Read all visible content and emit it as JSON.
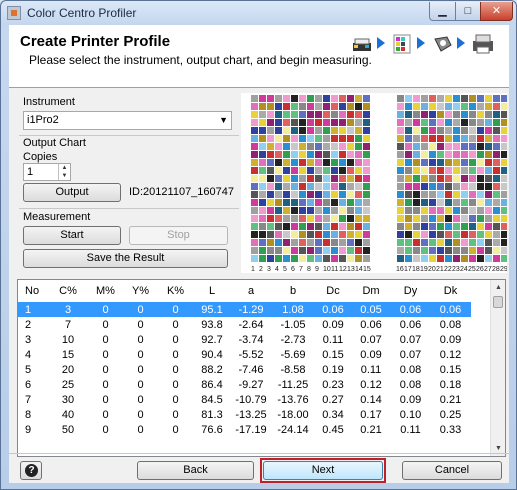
{
  "window": {
    "title": "Color Centro Profiler"
  },
  "header": {
    "title": "Create Printer Profile",
    "subtitle": "Please select the instrument, output chart, and begin measuring."
  },
  "instrument": {
    "label": "Instrument",
    "selected": "i1Pro2"
  },
  "output_chart": {
    "label": "Output Chart",
    "copies_label": "Copies",
    "copies_value": "1",
    "output_button": "Output",
    "id_text": "ID:20121107_160747"
  },
  "measurement": {
    "label": "Measurement",
    "start_button": "Start",
    "stop_button": "Stop",
    "save_button": "Save the Result"
  },
  "chart_labels": {
    "left": [
      "1",
      "2",
      "3",
      "4",
      "5",
      "6",
      "7",
      "8",
      "9",
      "10",
      "11",
      "12",
      "13",
      "14",
      "15"
    ],
    "right": [
      "16",
      "17",
      "18",
      "19",
      "20",
      "21",
      "22",
      "23",
      "24",
      "25",
      "26",
      "27",
      "28",
      "29"
    ]
  },
  "table": {
    "columns": [
      "No",
      "C%",
      "M%",
      "Y%",
      "K%",
      "L",
      "a",
      "b",
      "Dc",
      "Dm",
      "Dy",
      "Dk"
    ],
    "rows": [
      [
        "1",
        "3",
        "0",
        "0",
        "0",
        "95.1",
        "-1.29",
        "1.08",
        "0.06",
        "0.05",
        "0.06",
        "0.06"
      ],
      [
        "2",
        "7",
        "0",
        "0",
        "0",
        "93.8",
        "-2.64",
        "-1.05",
        "0.09",
        "0.06",
        "0.06",
        "0.08"
      ],
      [
        "3",
        "10",
        "0",
        "0",
        "0",
        "92.7",
        "-3.74",
        "-2.73",
        "0.11",
        "0.07",
        "0.07",
        "0.09"
      ],
      [
        "4",
        "15",
        "0",
        "0",
        "0",
        "90.4",
        "-5.52",
        "-5.69",
        "0.15",
        "0.09",
        "0.07",
        "0.12"
      ],
      [
        "5",
        "20",
        "0",
        "0",
        "0",
        "88.2",
        "-7.46",
        "-8.58",
        "0.19",
        "0.11",
        "0.08",
        "0.15"
      ],
      [
        "6",
        "25",
        "0",
        "0",
        "0",
        "86.4",
        "-9.27",
        "-11.25",
        "0.23",
        "0.12",
        "0.08",
        "0.18"
      ],
      [
        "7",
        "30",
        "0",
        "0",
        "0",
        "84.5",
        "-10.79",
        "-13.76",
        "0.27",
        "0.14",
        "0.09",
        "0.21"
      ],
      [
        "8",
        "40",
        "0",
        "0",
        "0",
        "81.3",
        "-13.25",
        "-18.00",
        "0.34",
        "0.17",
        "0.10",
        "0.25"
      ],
      [
        "9",
        "50",
        "0",
        "0",
        "0",
        "76.6",
        "-17.19",
        "-24.14",
        "0.45",
        "0.21",
        "0.11",
        "0.33"
      ]
    ],
    "selected_row": 0
  },
  "footer": {
    "help_label": "?",
    "back_button": "Back",
    "next_button": "Next",
    "cancel_button": "Cancel"
  },
  "colors": {
    "selection": "#3399ff",
    "focus_outline": "#c0202a",
    "step_arrow": "#1e6ed8"
  },
  "icons": [
    "printer-ink-icon",
    "chart-icon",
    "instrument-icon",
    "printer-icon"
  ]
}
